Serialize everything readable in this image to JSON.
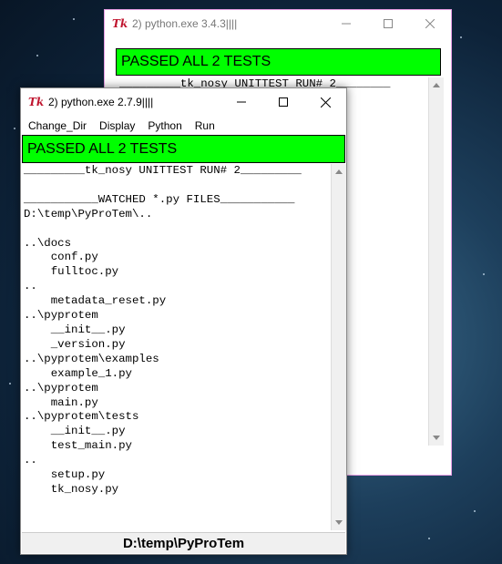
{
  "back_window": {
    "title": "2) python.exe 3.4.3||||",
    "banner": "PASSED ALL 2 TESTS",
    "log": "_________tk_nosy UNITTEST RUN# 2________\n\n\n________________________"
  },
  "front_window": {
    "title": "2) python.exe 2.7.9||||",
    "menu": [
      "Change_Dir",
      "Display",
      "Python",
      "Run"
    ],
    "banner": "PASSED ALL 2 TESTS",
    "log": "_________tk_nosy UNITTEST RUN# 2_________\n\n___________WATCHED *.py FILES___________\nD:\\temp\\PyProTem\\..\n\n..\\docs\n    conf.py\n    fulltoc.py\n..\n    metadata_reset.py\n..\\pyprotem\n    __init__.py\n    _version.py\n..\\pyprotem\\examples\n    example_1.py\n..\\pyprotem\n    main.py\n..\\pyprotem\\tests\n    __init__.py\n    test_main.py\n..\n    setup.py\n    tk_nosy.py",
    "status": "D:\\temp\\PyProTem"
  },
  "logo_text": "Tk",
  "icons": {
    "minimize": "minimize-icon",
    "maximize": "maximize-icon",
    "close": "close-icon",
    "scroll_up": "arrow-up-icon",
    "scroll_down": "arrow-down-icon"
  },
  "colors": {
    "banner_green": "#00ff00",
    "tk_logo_red": "#c0152f",
    "back_window_border": "#e79ce3"
  }
}
